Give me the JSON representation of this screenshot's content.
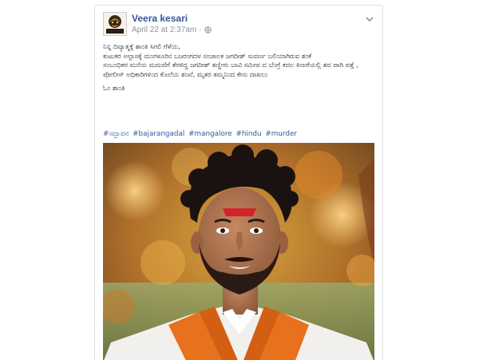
{
  "post": {
    "author": "Veera kesari",
    "timestamp": "April 22 at 2:37am",
    "separator": "·",
    "privacy_icon": "globe-icon",
    "menu_icon": "chevron-down-icon",
    "avatar_text": "VEERA KESARI",
    "body_lines": [
      "ನಿನ್ನ ದಿವ್ಯಾತ್ಮಕ್ಕೆ ಶಾಂತಿ ಸಿಗಲಿ ಗೆಳೆಯ,",
      "ಕುಟುಕರ ಅಲ್ಪಾಸಕ್ಕೆ ಮಂಗಳೂರಿನ ಬಜರಂಗದಳ ಸಂಚಾಲಕ ಜಗದೀಶ್ ಸುವರ್ಣ ಬಲಿಯಾಗಿರುವ ಶಂಕೆ",
      "ಸಂಬಂಧಿಕರ ಮನೆಯ ಮದುವೆಗೆ ತೆರಳಿದ್ದ ಜಗದೀಶ್ ತಣ್ಣೀರು ಬಾವಿ ಸಮೀಪ ದ ಬೆಂಗ್ರೆ ಕದಲ ಕಿನಾರೆಯಲ್ಲಿ ಶವ ಪಾಗಿ ಪತ್ತೆ ,",
      "ಪೋಲೀಸ್ ಅಧಿಕಾರಿಗಳಿಂದ ಕೊಲೆಯ ಶಂಖೆ, ಮೃತರ ತಮ್ಮನಿಂದ ಕೇಸು ದಾಖಲು"
    ],
    "closing_line": "ಓಂ ಶಾಂತಿ",
    "hashtags": [
      "#ಸದ್ಭಾವನ",
      "#bajarangadal",
      "#mangalore",
      "#hindu",
      "#murder"
    ],
    "image_alt": "Photo of a young man with curly hair, beard, red tilak, white shirt and saffron scarf against autumn foliage"
  },
  "colors": {
    "link": "#365899",
    "meta": "#90949c",
    "text": "#1d2129",
    "saffron": "#e8711e",
    "border": "#dddfe2"
  }
}
